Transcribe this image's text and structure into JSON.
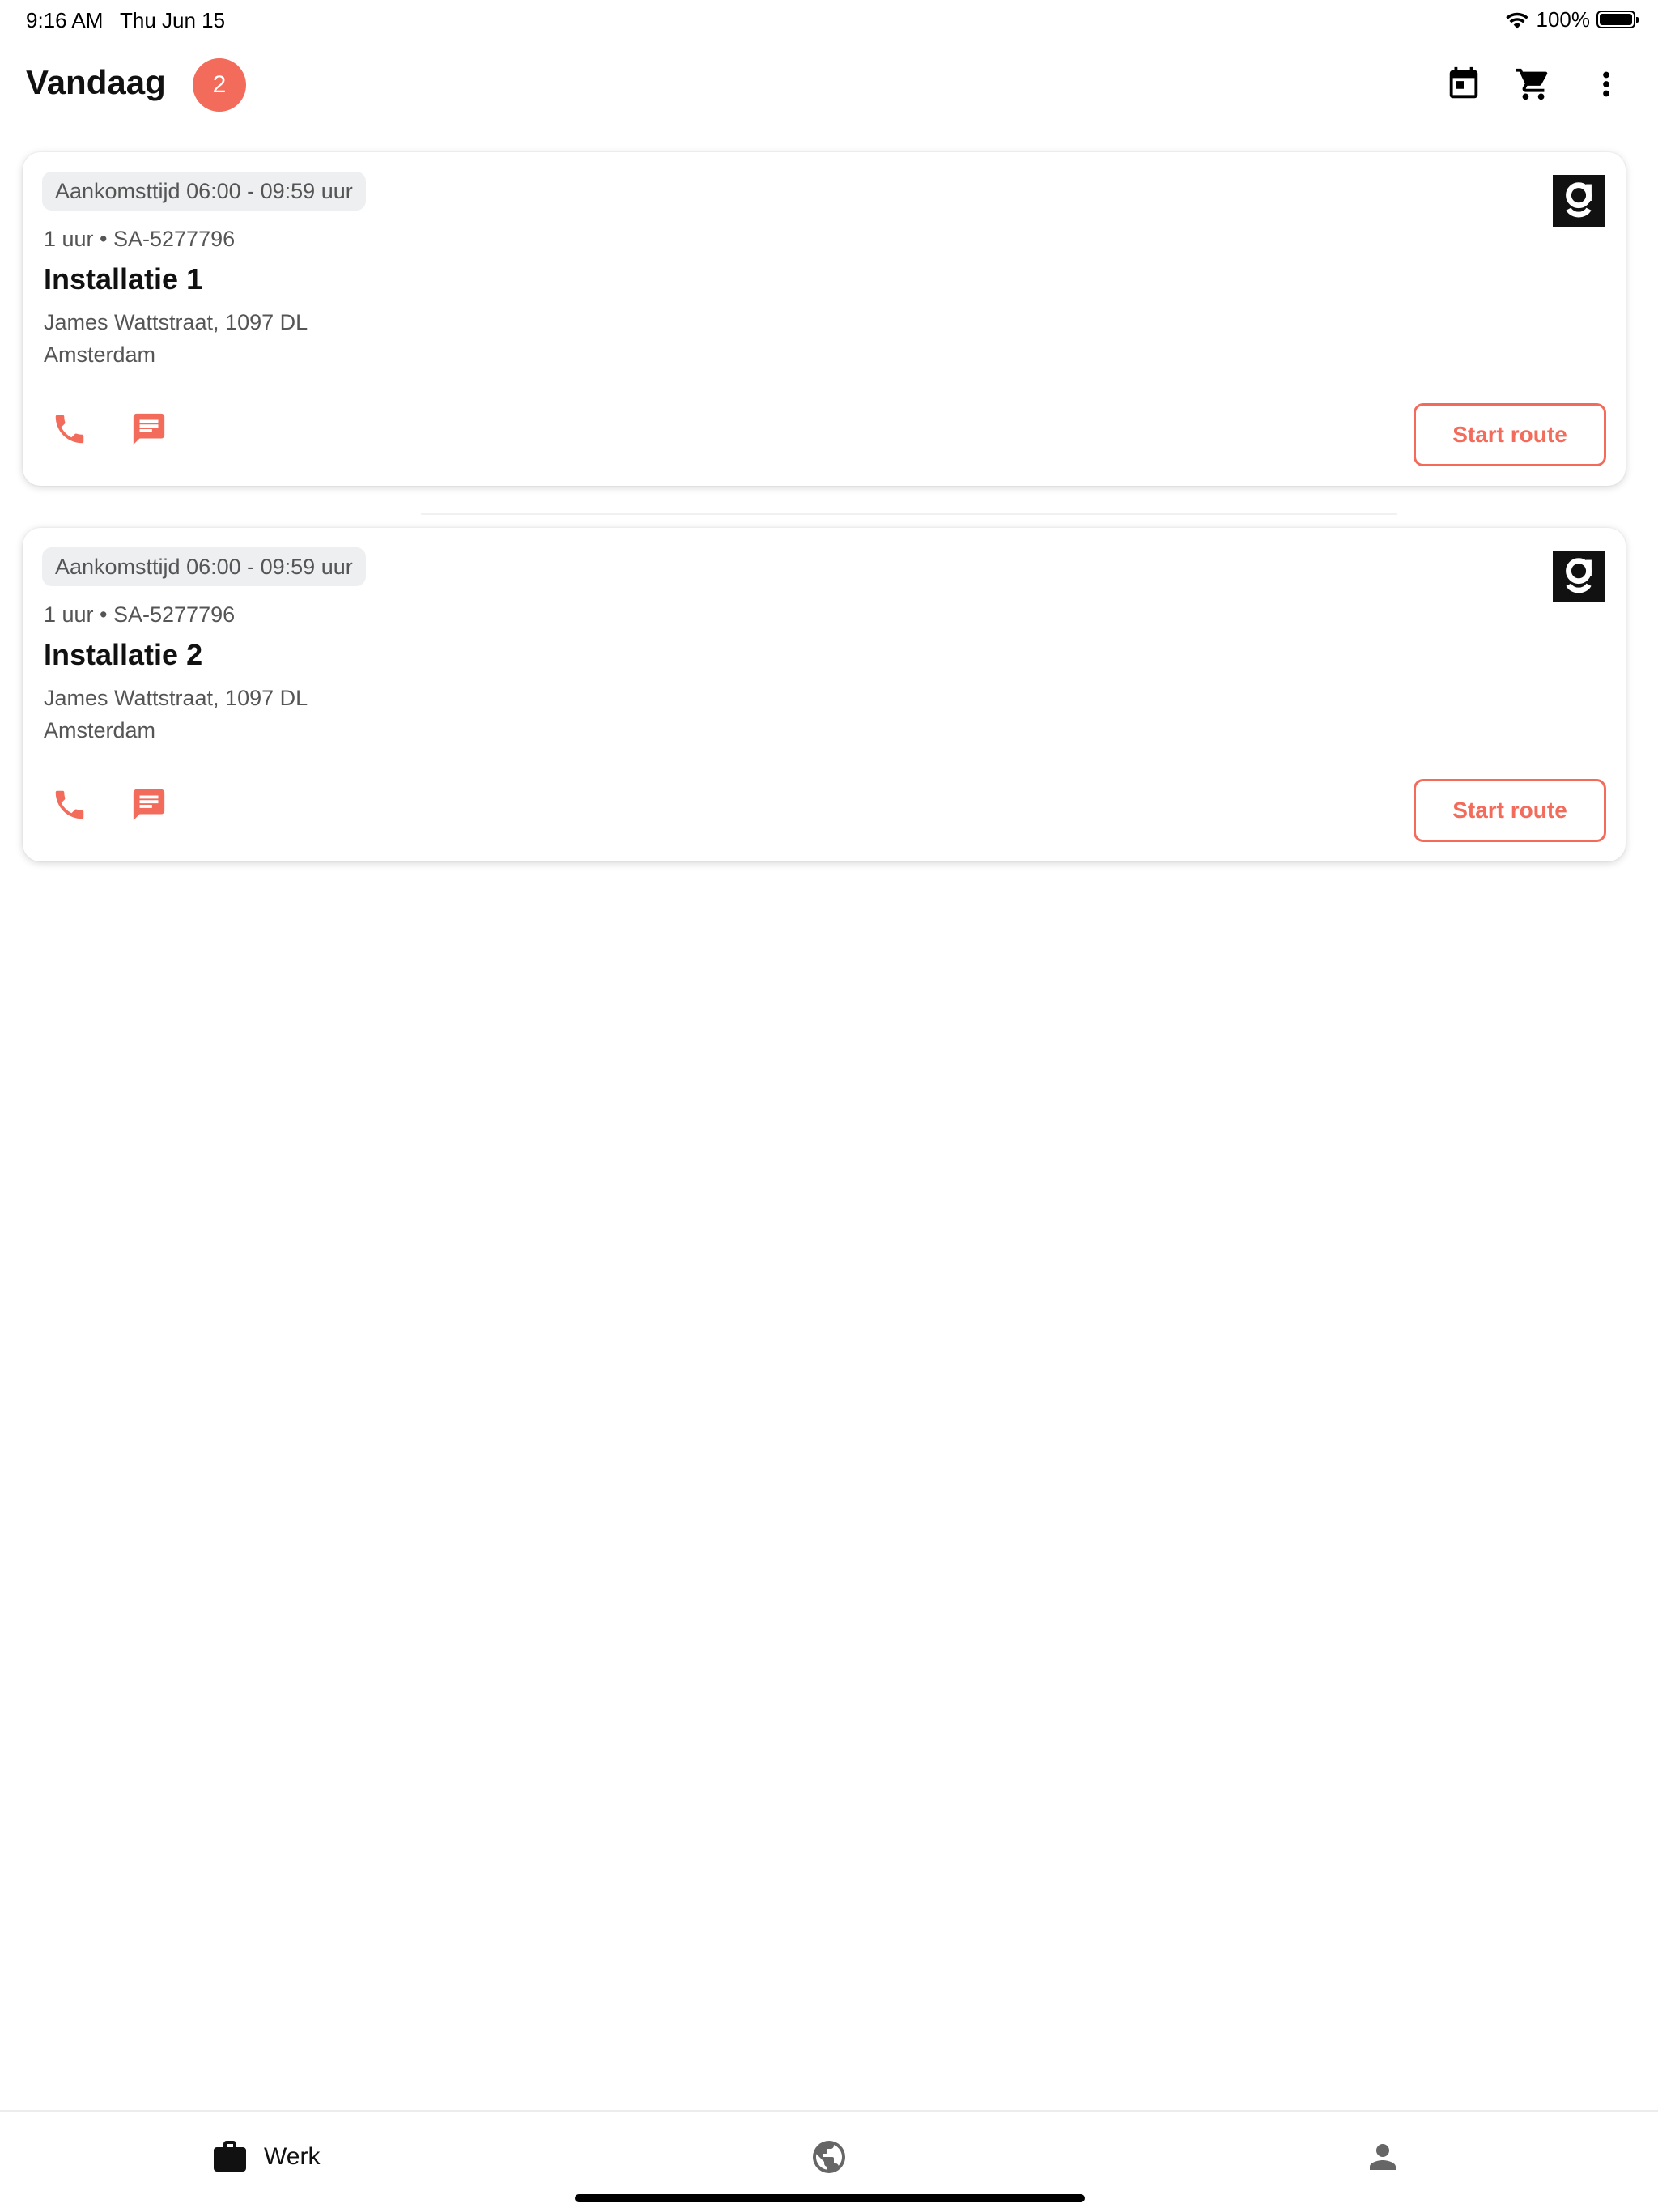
{
  "status_bar": {
    "time": "9:16 AM",
    "date": "Thu Jun 15",
    "battery": "100%",
    "wifi_icon": "wifi-icon",
    "battery_icon": "battery-icon"
  },
  "header": {
    "title": "Vandaag",
    "count": "2",
    "icons": [
      "calendar-icon",
      "cart-icon",
      "more-vertical-icon"
    ]
  },
  "colors": {
    "accent": "#f26b5b",
    "chip_bg": "#edeff1",
    "text_primary": "#111111",
    "text_secondary": "#555555"
  },
  "jobs": [
    {
      "arrival": "Aankomsttijd 06:00 - 09:59 uur",
      "meta": "1 uur • SA-5277796",
      "title": "Installatie 1",
      "address_line1": "James Wattstraat, 1097 DL",
      "address_line2": "Amsterdam",
      "action_label": "Start route"
    },
    {
      "arrival": "Aankomsttijd 06:00 - 09:59 uur",
      "meta": "1 uur • SA-5277796",
      "title": "Installatie 2",
      "address_line1": "James Wattstraat, 1097 DL",
      "address_line2": "Amsterdam",
      "action_label": "Start route"
    }
  ],
  "bottom_nav": {
    "items": [
      {
        "label": "Werk",
        "icon": "briefcase-icon",
        "active": true
      },
      {
        "label": "",
        "icon": "globe-icon",
        "active": false
      },
      {
        "label": "",
        "icon": "person-icon",
        "active": false
      }
    ]
  }
}
